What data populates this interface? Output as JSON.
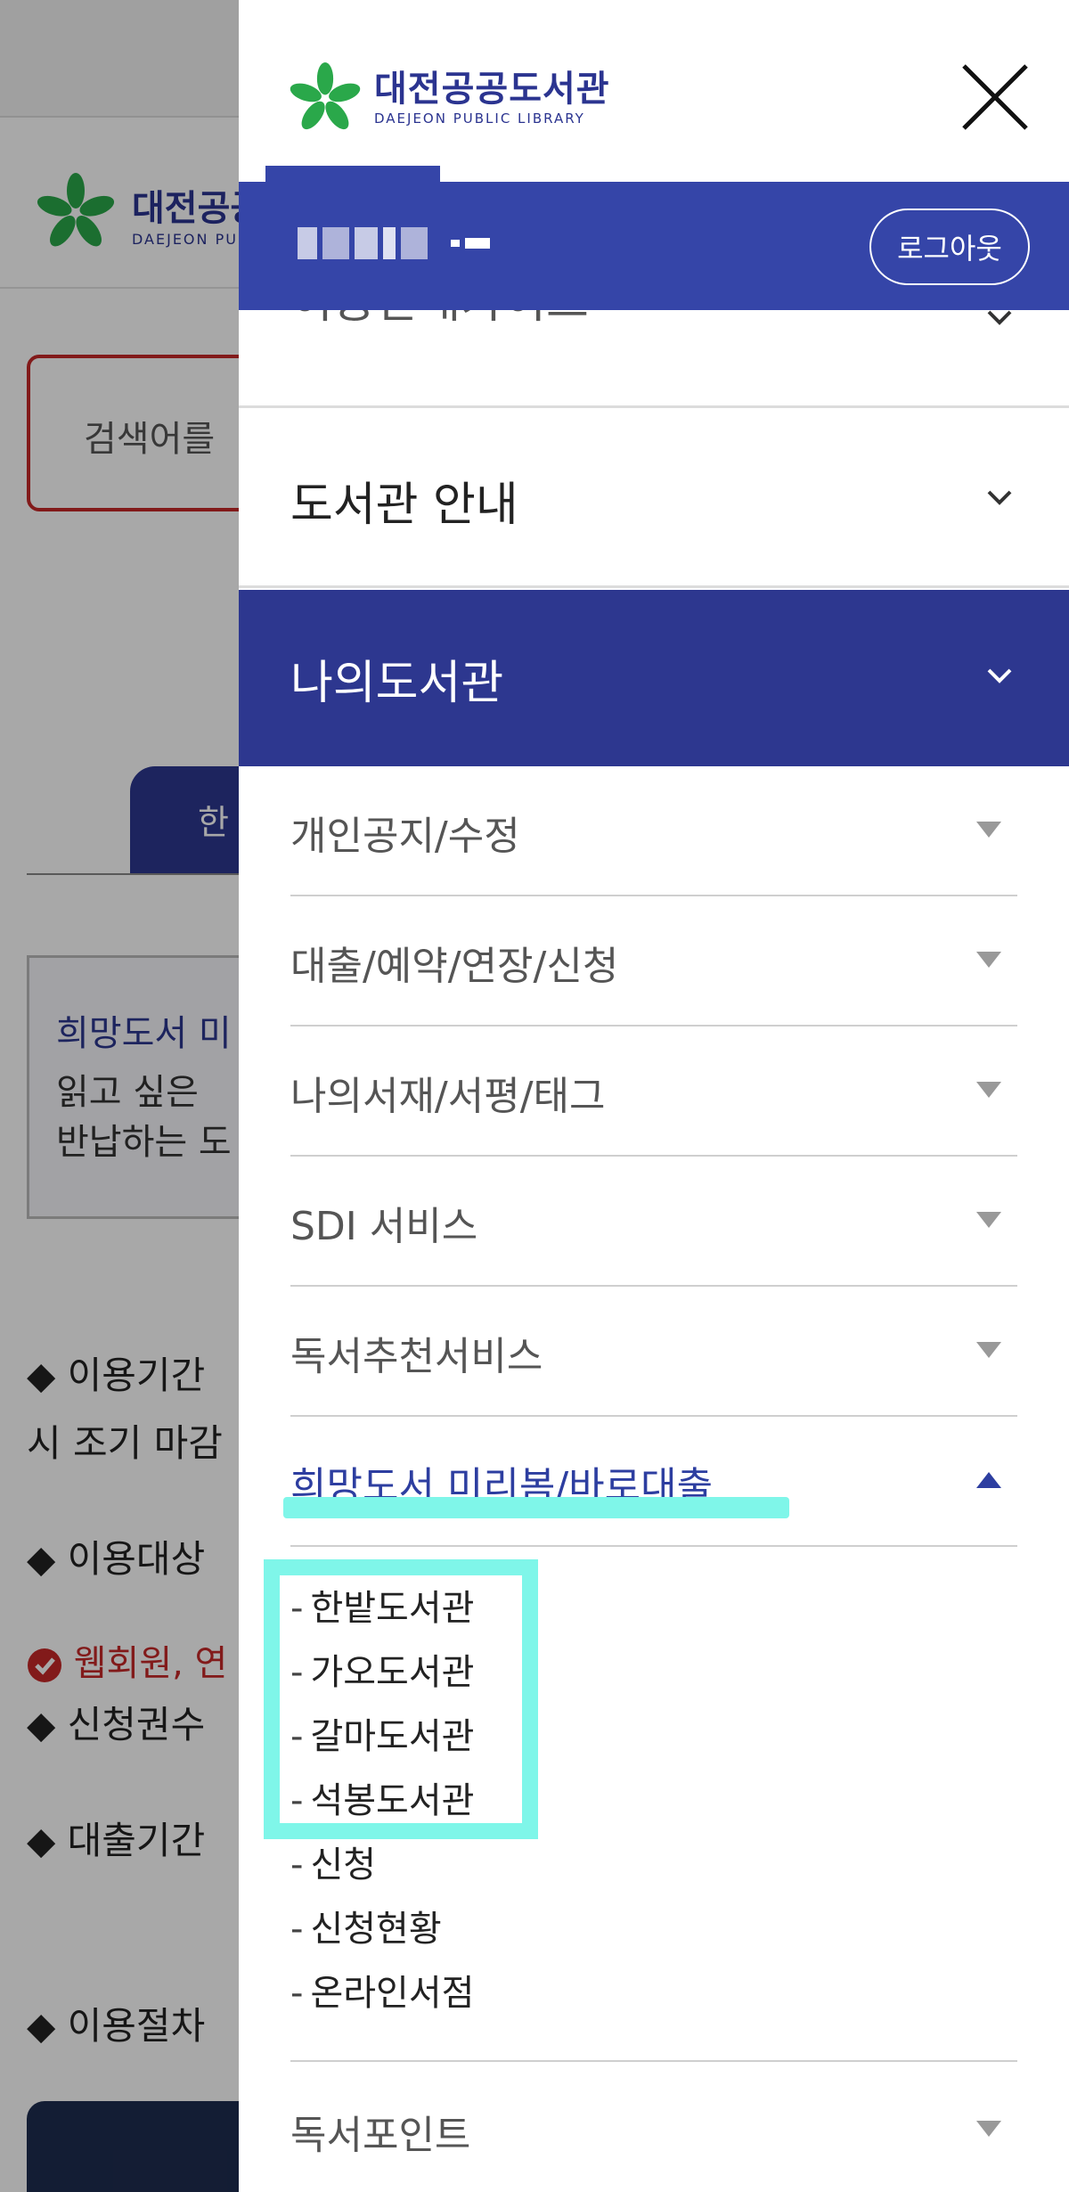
{
  "background": {
    "logo_title": "대전공공",
    "logo_sub": "DAEJEON PUBL",
    "search_placeholder": "검색어를",
    "tab_label": "한",
    "notice_title": "희망도서 미",
    "notice_line1": "읽고 싶은",
    "notice_line2": "반납하는 도",
    "line_period": "◆ 이용기간",
    "line_period2": "시 조기 마감",
    "line_target": "◆ 이용대상",
    "line_web": "웹회원, 연",
    "line_count": "◆ 신청권수",
    "line_loan": "◆ 대출기간",
    "line_proc": "◆ 이용절차"
  },
  "drawer": {
    "logo": {
      "title": "대전공공도서관",
      "subtitle": "DAEJEON PUBLIC LIBRARY"
    },
    "logout_label": "로그아웃",
    "menu": {
      "partial_label": "이용안내가이드",
      "library_guide": "도서관 안내",
      "my_library": "나의도서관"
    },
    "sub_menu": [
      {
        "label": "개인공지/수정"
      },
      {
        "label": "대출/예약/연장/신청"
      },
      {
        "label": "나의서재/서평/태그"
      },
      {
        "label": "SDI 서비스"
      },
      {
        "label": "독서추천서비스"
      },
      {
        "label": "희망도서 미리봄/바로대출"
      }
    ],
    "expanded_items": [
      "한밭도서관",
      "가오도서관",
      "갈마도서관",
      "석봉도서관",
      "신청",
      "신청현황",
      "온라인서점"
    ],
    "last_row": "독서포인트"
  },
  "colors": {
    "brand": "#2d378f",
    "user_bar": "#3545a8",
    "highlight": "#7ff6e9",
    "logo_green": "#2aa84a"
  }
}
